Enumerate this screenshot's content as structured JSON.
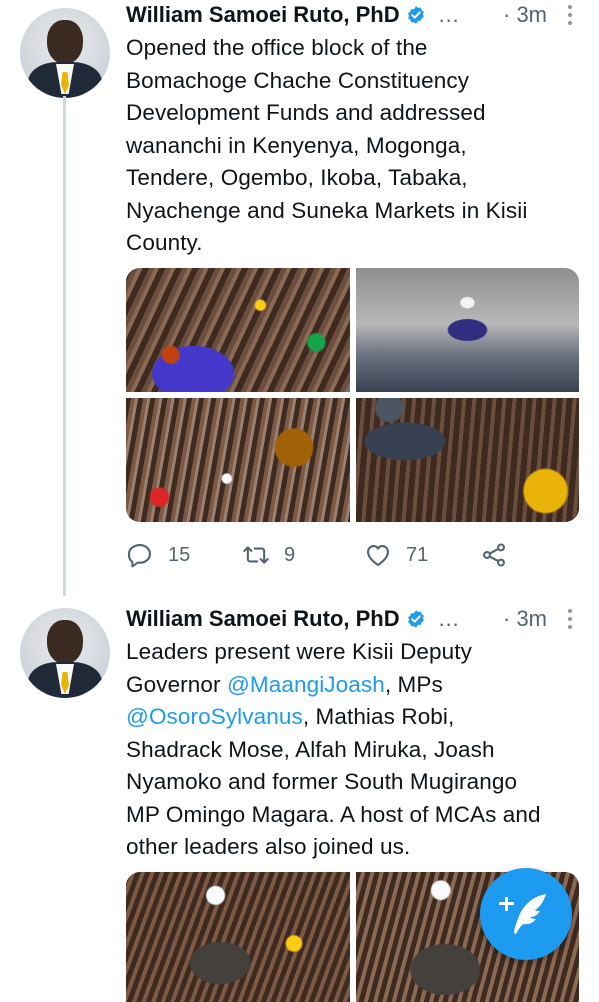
{
  "tweets": [
    {
      "author": "William Samoei Ruto, PhD",
      "ellipsis": "…",
      "time": "· 3m",
      "text": "Opened the office block of the\nBomachoge Chache Constituency\nDevelopment Funds and addressed\nwananchi in Kenyenya, Mogonga,\nTendere, Ogembo, Ikoba, Tabaka,\nNyachenge and Suneka Markets in Kisii\nCounty.",
      "replies": "15",
      "retweets": "9",
      "likes": "71"
    },
    {
      "author": "William Samoei Ruto, PhD",
      "ellipsis": "…",
      "time": "· 3m",
      "text_parts": [
        "Leaders present were Kisii Deputy\nGovernor ",
        "@MaangiJoash",
        ", MPs\n",
        "@OsoroSylvanus",
        ", Mathias Robi,\nShadrack Mose, Alfah Miruka, Joash\nNyamoko and former South Mugirango\nMP Omingo Magara. A host of MCAs and\nother leaders also joined us."
      ]
    }
  ],
  "icons": {
    "verified": "verified-badge-icon",
    "reply": "reply-icon",
    "retweet": "retweet-icon",
    "like": "heart-icon",
    "share": "share-icon",
    "compose": "compose-tweet-icon"
  },
  "colors": {
    "link": "#1d9bf0",
    "muted": "#536471",
    "fab": "#1d9bf0"
  }
}
